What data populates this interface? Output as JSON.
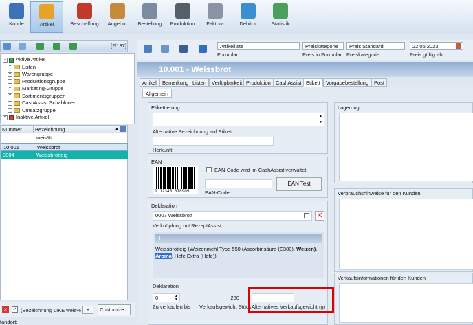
{
  "ribbon": [
    {
      "label": "Kunde",
      "icon": "customer-icon",
      "color": "#3c73b8"
    },
    {
      "label": "Artikel",
      "icon": "article-icon",
      "color": "#e8a22a"
    },
    {
      "label": "Beschaffung",
      "icon": "cart-icon",
      "color": "#c0392b"
    },
    {
      "label": "Angebot",
      "icon": "handshake-icon",
      "color": "#c68a3a"
    },
    {
      "label": "Bestellung",
      "icon": "order-icon",
      "color": "#7d8ba0"
    },
    {
      "label": "Produktion",
      "icon": "production-icon",
      "color": "#555f6b"
    },
    {
      "label": "Faktura",
      "icon": "invoice-icon",
      "color": "#8a94a4"
    },
    {
      "label": "Debitor",
      "icon": "debtor-icon",
      "color": "#3a8fd0"
    },
    {
      "label": "Statistik",
      "icon": "statistics-icon",
      "color": "#4aa05a"
    }
  ],
  "left": {
    "counter": "[2/137]",
    "tree": [
      {
        "label": "Aktive Artikel",
        "level": 0,
        "kind": "root-active"
      },
      {
        "label": "Listen",
        "level": 1
      },
      {
        "label": "Warengruppe",
        "level": 1
      },
      {
        "label": "Produktionsgruppe",
        "level": 1
      },
      {
        "label": "Marketing-Gruppe",
        "level": 1
      },
      {
        "label": "Sortimentsgruppen",
        "level": 1
      },
      {
        "label": "CashAssist Schablonen",
        "level": 1
      },
      {
        "label": "Umsatzgruppe",
        "level": 1
      },
      {
        "label": "Inaktive Artikel",
        "level": 0,
        "kind": "root-inactive"
      }
    ],
    "grid": {
      "col_number": "Nummer",
      "col_name": "Bezeichnung",
      "filter": "weis%",
      "rows": [
        {
          "number": "10.001",
          "name": "Weissbrot"
        },
        {
          "number": "9004",
          "name": "Weissbrotteig"
        }
      ]
    },
    "filter_text": "(Bezeichnung LIKE weis%",
    "customize": "Customize...",
    "status": "tandort:"
  },
  "header": {
    "formular_value": "Artikelliste",
    "formular_label": "Formular",
    "preiskat_value": "Preiskategorie",
    "preiskat_label": "Preis in Formular",
    "preisstd_value": "Preis Standard",
    "preisstd_label": "Preiskategorie",
    "date_value": "22.05.2023",
    "date_label": "Preis gültig ab"
  },
  "title": "10.001 - Weissbrot",
  "tabs": [
    "Artikel",
    "Bemerkung",
    "Listen",
    "Verfügbarkeit",
    "Produktion",
    "CashAssist",
    "Etikett",
    "Vorgabebestellung",
    "Post"
  ],
  "subtab": "Allgemein",
  "etikett": {
    "group": "Etikettierung",
    "alt_label": "Alternative Bezeichnung auf Etikett",
    "herkunft": "Herkunft"
  },
  "ean": {
    "group": "EAN",
    "checkbox": "EAN-Code wird im CashAssist verwaltet",
    "code_label": "EAN-Code",
    "button": "EAN Test",
    "barcode": "0 12345 678905"
  },
  "deklaration": {
    "group": "Deklaration",
    "value": "0007  Weissbrott",
    "link_label": "Verknüpfung mit RezeptAssist",
    "editor_head": "F",
    "text_a": "Weissbrotteig (Weizenmehl Type 550 (Ascorbinsäure (E300), ",
    "text_b": "Weizen)",
    "text_c": ", ",
    "text_d": "Aroma",
    "text_e": ", Hefe Extra (Hefe))",
    "dekl2": "Deklaration",
    "sell_value": "0",
    "sell_label": "Zu verkaufen bis",
    "weight_value": "280",
    "weight_label": "Verkaufsgewicht Stück",
    "altweight_label": "Alternatives Verkaufsgewicht (g)"
  },
  "right_groups": {
    "lagerung": "Lagerung",
    "verbrauch": "Verbrauchshinweise für den Kunden",
    "verkauf": "Verkaufsinformationen für den Kunden"
  },
  "highlight_color": "#e00000"
}
